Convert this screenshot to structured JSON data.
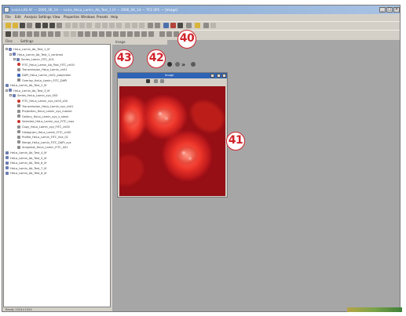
{
  "window": {
    "title": "Leica LAS AF — 2006_06_14 — Leica_HeLa_Lamin_Ab_Test_1.lif — 2006_06_14 — TCS SP5 — [Image]",
    "controls": [
      "_",
      "□",
      "×"
    ]
  },
  "menu": [
    "File",
    "Edit",
    "Analysis",
    "Settings",
    "View",
    "Properties",
    "Windows",
    "Presets",
    "Help"
  ],
  "left_panel": {
    "tabs": [
      "Files",
      "Settings"
    ],
    "tree": [
      {
        "level": 0,
        "icon": "folder",
        "label": "HeLa_Lamin_Ab_Test_1_lif",
        "expanded": true
      },
      {
        "level": 1,
        "icon": "folder",
        "label": "HeLa_Lamin_Ab_Test_1_contrast",
        "expanded": true
      },
      {
        "level": 2,
        "icon": "folder",
        "label": "Series_Lamin_FITC_001",
        "expanded": true
      },
      {
        "level": 3,
        "icon": "red",
        "label": "FITC_HeLa_Lamin_Ab_Test_FITC_ch00"
      },
      {
        "level": 3,
        "icon": "grey",
        "label": "Transmission_HeLa_Lamin_ch01"
      },
      {
        "level": 3,
        "icon": "blue",
        "label": "DAPI_HeLa_Lamin_ch02_projection"
      },
      {
        "level": 3,
        "icon": "grey",
        "label": "Overlay_HeLa_Lamin_FITC_DAPI"
      },
      {
        "level": 0,
        "icon": "folder",
        "label": "HeLa_Lamin_Ab_Test_2_lif"
      },
      {
        "level": 0,
        "icon": "folder",
        "label": "HeLa_Lamin_Ab_Test_3_lif",
        "expanded": true
      },
      {
        "level": 1,
        "icon": "folder",
        "label": "Series_HeLa_Lamin_xyz_003",
        "expanded": true
      },
      {
        "level": 3,
        "icon": "red",
        "label": "FITC_HeLa_Lamin_xyz_ch00_z00"
      },
      {
        "level": 3,
        "icon": "grey",
        "label": "Transmission_HeLa_Lamin_xyz_ch01"
      },
      {
        "level": 3,
        "icon": "grey",
        "label": "Projection_HeLa_Lamin_xyz_maxint"
      },
      {
        "level": 3,
        "icon": "grey",
        "label": "Gallery_HeLa_Lamin_xyz_z_stack"
      },
      {
        "level": 3,
        "icon": "red",
        "label": "Selected_HeLa_Lamin_xyz_FITC_max"
      },
      {
        "level": 3,
        "icon": "grey",
        "label": "Copy_HeLa_Lamin_xyz_FITC_ch00"
      },
      {
        "level": 3,
        "icon": "grey",
        "label": "Histogram_HeLa_Lamin_FITC_ch00"
      },
      {
        "level": 3,
        "icon": "grey",
        "label": "Profile_HeLa_Lamin_FITC_line_01"
      },
      {
        "level": 3,
        "icon": "grey",
        "label": "Merge_HeLa_Lamin_FITC_DAPI_xyz"
      },
      {
        "level": 3,
        "icon": "grey",
        "label": "Snapshot_HeLa_Lamin_FITC_001"
      },
      {
        "level": 0,
        "icon": "folder",
        "label": "HeLa_Lamin_Ab_Test_4_lif"
      },
      {
        "level": 0,
        "icon": "folder",
        "label": "HeLa_Lamin_Ab_Test_5_lif"
      },
      {
        "level": 0,
        "icon": "folder",
        "label": "HeLa_Lamin_Ab_Test_6_lif"
      },
      {
        "level": 0,
        "icon": "folder",
        "label": "HeLa_Lamin_Ab_Test_7_lif"
      },
      {
        "level": 0,
        "icon": "folder",
        "label": "HeLa_Lamin_Ab_Test_8_lif"
      }
    ],
    "status": "Ready   1024×1024"
  },
  "workspace": {
    "header": "Image",
    "image_window_title": "Image",
    "colors": {
      "background": "#a6a6a6",
      "image_tint": "#ff3b2e",
      "titlebar": "#2e63b6"
    }
  },
  "callouts": {
    "c40": "40",
    "c41": "41",
    "c42": "42",
    "c43": "43"
  },
  "icons": [
    "new-icon",
    "open-icon",
    "save-icon",
    "print-icon",
    "zoom-icon",
    "channel-icon",
    "lut-icon",
    "overlay-icon",
    "settings-icon",
    "chevron-right-icon"
  ]
}
